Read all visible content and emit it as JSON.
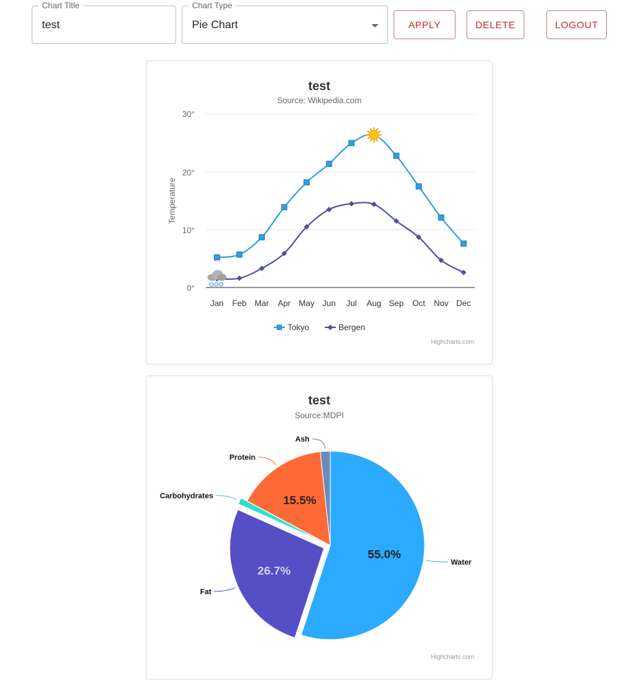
{
  "form": {
    "chart_title_label": "Chart Title",
    "chart_title_value": "test",
    "chart_type_label": "Chart Type",
    "chart_type_value": "Pie Chart",
    "apply_label": "APPLY",
    "delete_label": "DELETE",
    "logout_label": "LOGOUT"
  },
  "line_card": {
    "title": "test",
    "subtitle": "Source: Wikipedia.com",
    "credit": "Highcharts.com",
    "y_ticks": [
      "0°",
      "10°",
      "20°",
      "30°"
    ]
  },
  "pie_card": {
    "title": "test",
    "subtitle": "Source:MDPI",
    "credit": "Highcharts.com"
  },
  "chart_data": [
    {
      "type": "line",
      "title": "test",
      "subtitle": "Source: Wikipedia.com",
      "ylabel": "Temperature",
      "xlabel": "",
      "ylim": [
        0,
        30
      ],
      "grid": true,
      "legend_placement": "bottom-center",
      "categories": [
        "Jan",
        "Feb",
        "Mar",
        "Apr",
        "May",
        "Jun",
        "Jul",
        "Aug",
        "Sep",
        "Oct",
        "Nov",
        "Dec"
      ],
      "series": [
        {
          "name": "Tokyo",
          "color": "#2f9fe0",
          "marker": "square",
          "values": [
            5.2,
            5.7,
            8.7,
            13.9,
            18.2,
            21.4,
            25.0,
            26.4,
            22.8,
            17.5,
            12.1,
            7.6
          ]
        },
        {
          "name": "Bergen",
          "color": "#4e4ca6",
          "marker": "diamond",
          "values": [
            1.5,
            1.6,
            3.3,
            5.9,
            10.5,
            13.5,
            14.5,
            14.4,
            11.5,
            8.7,
            4.7,
            2.6
          ]
        }
      ],
      "annotations": [
        {
          "type": "sun-icon",
          "category": "Aug"
        },
        {
          "type": "snow-cloud-icon",
          "category": "Jan"
        }
      ]
    },
    {
      "type": "pie",
      "title": "test",
      "subtitle": "Source:MDPI",
      "slices": [
        {
          "name": "Water",
          "value": 55.0,
          "color": "#2caafe",
          "label": "55.0%",
          "sliced": false
        },
        {
          "name": "Fat",
          "value": 26.7,
          "color": "#544fc5",
          "label": "26.7%",
          "sliced": true
        },
        {
          "name": "Carbohydrates",
          "value": 1.1,
          "color": "#2ee0ca",
          "sliced": true
        },
        {
          "name": "Protein",
          "value": 15.5,
          "color": "#fe6a35",
          "label": "15.5%",
          "sliced": false
        },
        {
          "name": "Ash",
          "value": 1.7,
          "color": "#6b8abc",
          "sliced": false
        }
      ]
    }
  ]
}
